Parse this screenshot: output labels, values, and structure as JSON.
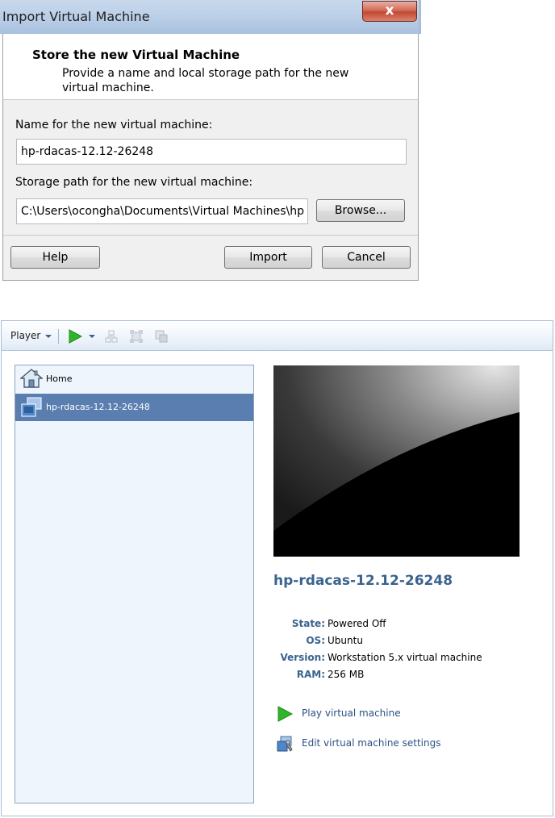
{
  "dialog": {
    "title": "Import Virtual Machine",
    "close_label": "x",
    "heading": "Store the new Virtual Machine",
    "subheading": "Provide a name and local storage path for the new virtual machine.",
    "name_label": "Name for the new virtual machine:",
    "name_value": "hp-rdacas-12.12-26248",
    "path_label": "Storage path for the new virtual machine:",
    "path_value": "C:\\Users\\ocongha\\Documents\\Virtual Machines\\hp",
    "browse_label": "Browse...",
    "help_label": "Help",
    "import_label": "Import",
    "cancel_label": "Cancel"
  },
  "player": {
    "menu_label": "Player",
    "library": {
      "items": [
        {
          "label": "Home",
          "icon": "home-icon",
          "selected": false
        },
        {
          "label": "hp-rdacas-12.12-26248",
          "icon": "vm-icon",
          "selected": true
        }
      ]
    },
    "vm": {
      "title": "hp-rdacas-12.12-26248",
      "details": [
        {
          "key": "State:",
          "value": "Powered Off"
        },
        {
          "key": "OS:",
          "value": "Ubuntu"
        },
        {
          "key": "Version:",
          "value": "Workstation 5.x virtual machine"
        },
        {
          "key": "RAM:",
          "value": "256 MB"
        }
      ],
      "actions": [
        {
          "label": "Play virtual machine",
          "icon": "play-icon"
        },
        {
          "label": "Edit virtual machine settings",
          "icon": "settings-icon"
        }
      ]
    },
    "colors": {
      "accent": "#3a638d",
      "selection": "#5a7eaf",
      "play_green": "#2fb52a"
    }
  }
}
